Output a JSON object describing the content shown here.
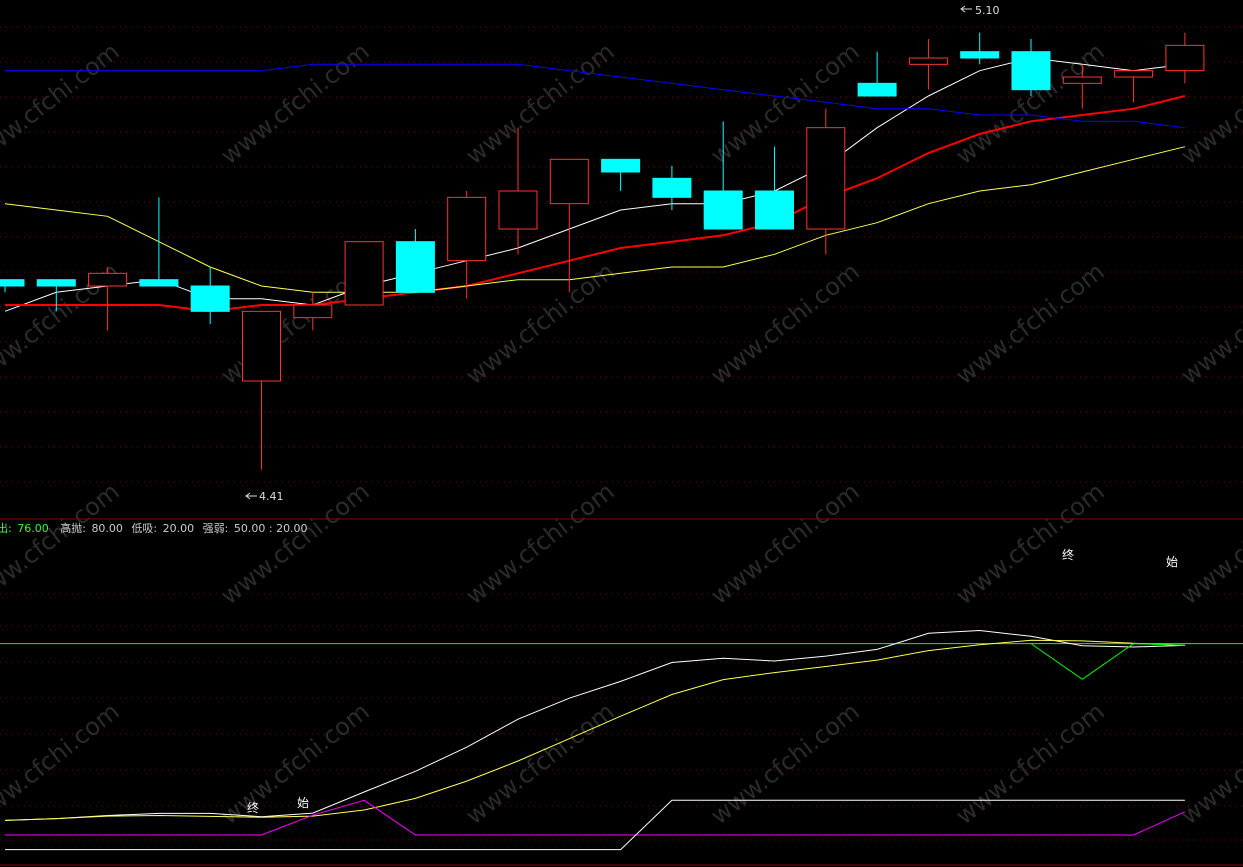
{
  "price_labels": {
    "high": "5.10",
    "low": "4.41"
  },
  "indicator_header": {
    "sell_label": "卖出:",
    "sell_value": "76.00",
    "high_label": "高抛:",
    "high_value": "80.00",
    "low_label": "低吸:",
    "low_value": "20.00",
    "strength_label": "强弱:",
    "strength_value": "50.00 : 20.00"
  },
  "markers": {
    "end": "终",
    "start": "始"
  },
  "watermark": "www.cfchi.com",
  "colors": {
    "background": "#000000",
    "up_candle": "#ff3232",
    "down_candle": "#00ffff",
    "ma_white": "#ffffff",
    "ma_red": "#ff0000",
    "ma_yellow": "#ffff55",
    "ma_blue": "#0000ff",
    "grid": "#8b0000",
    "osc_green": "#00ff00",
    "osc_magenta": "#ff00ff"
  },
  "chart_data": [
    {
      "type": "candlestick",
      "x": [
        0,
        1,
        2,
        3,
        4,
        5,
        6,
        7,
        8,
        9,
        10,
        11,
        12,
        13,
        14,
        15,
        16,
        17,
        18,
        19,
        20,
        21,
        22,
        23
      ],
      "candles": [
        {
          "o": 4.71,
          "h": 4.71,
          "l": 4.69,
          "c": 4.7
        },
        {
          "o": 4.71,
          "h": 4.71,
          "l": 4.66,
          "c": 4.7
        },
        {
          "o": 4.7,
          "h": 4.73,
          "l": 4.63,
          "c": 4.72
        },
        {
          "o": 4.71,
          "h": 4.84,
          "l": 4.7,
          "c": 4.7
        },
        {
          "o": 4.7,
          "h": 4.73,
          "l": 4.64,
          "c": 4.66
        },
        {
          "o": 4.55,
          "h": 4.66,
          "l": 4.41,
          "c": 4.66
        },
        {
          "o": 4.65,
          "h": 4.69,
          "l": 4.63,
          "c": 4.67
        },
        {
          "o": 4.67,
          "h": 4.77,
          "l": 4.67,
          "c": 4.77
        },
        {
          "o": 4.77,
          "h": 4.79,
          "l": 4.69,
          "c": 4.69
        },
        {
          "o": 4.74,
          "h": 4.85,
          "l": 4.68,
          "c": 4.84
        },
        {
          "o": 4.79,
          "h": 4.95,
          "l": 4.75,
          "c": 4.85
        },
        {
          "o": 4.83,
          "h": 4.9,
          "l": 4.69,
          "c": 4.9
        },
        {
          "o": 4.9,
          "h": 4.9,
          "l": 4.85,
          "c": 4.88
        },
        {
          "o": 4.87,
          "h": 4.89,
          "l": 4.82,
          "c": 4.84
        },
        {
          "o": 4.85,
          "h": 4.96,
          "l": 4.79,
          "c": 4.79
        },
        {
          "o": 4.85,
          "h": 4.92,
          "l": 4.8,
          "c": 4.79
        },
        {
          "o": 4.79,
          "h": 4.98,
          "l": 4.75,
          "c": 4.95
        },
        {
          "o": 5.02,
          "h": 5.07,
          "l": 5.01,
          "c": 5.0
        },
        {
          "o": 5.05,
          "h": 5.09,
          "l": 5.01,
          "c": 5.06
        },
        {
          "o": 5.07,
          "h": 5.1,
          "l": 5.05,
          "c": 5.06
        },
        {
          "o": 5.07,
          "h": 5.09,
          "l": 5.0,
          "c": 5.01
        },
        {
          "o": 5.02,
          "h": 5.05,
          "l": 4.98,
          "c": 5.03
        },
        {
          "o": 5.03,
          "h": 5.04,
          "l": 4.99,
          "c": 5.04
        },
        {
          "o": 5.04,
          "h": 5.1,
          "l": 5.02,
          "c": 5.08
        }
      ],
      "moving_averages": [
        {
          "color": "ma_white",
          "values": [
            4.66,
            4.69,
            4.7,
            4.71,
            4.68,
            4.68,
            4.67,
            4.7,
            4.72,
            4.74,
            4.76,
            4.79,
            4.82,
            4.83,
            4.83,
            4.85,
            4.89,
            4.95,
            5.0,
            5.04,
            5.06,
            5.05,
            5.04,
            5.05
          ]
        },
        {
          "color": "ma_red",
          "values": [
            4.67,
            4.67,
            4.67,
            4.67,
            4.66,
            4.67,
            4.67,
            4.68,
            4.69,
            4.7,
            4.72,
            4.74,
            4.76,
            4.77,
            4.78,
            4.8,
            4.84,
            4.87,
            4.91,
            4.94,
            4.96,
            4.97,
            4.98,
            5.0
          ]
        },
        {
          "color": "ma_yellow",
          "values": [
            4.83,
            4.82,
            4.81,
            4.77,
            4.73,
            4.7,
            4.69,
            4.69,
            4.69,
            4.7,
            4.71,
            4.71,
            4.72,
            4.73,
            4.73,
            4.75,
            4.78,
            4.8,
            4.83,
            4.85,
            4.86,
            4.88,
            4.9,
            4.92
          ]
        },
        {
          "color": "ma_blue",
          "values": [
            5.04,
            5.04,
            5.04,
            5.04,
            5.04,
            5.04,
            5.05,
            5.05,
            5.05,
            5.05,
            5.05,
            5.04,
            5.03,
            5.02,
            5.01,
            5.0,
            4.99,
            4.98,
            4.98,
            4.97,
            4.97,
            4.96,
            4.96,
            4.95
          ]
        }
      ],
      "ylim": [
        4.37,
        5.12
      ]
    },
    {
      "type": "line",
      "x": [
        0,
        1,
        2,
        3,
        4,
        5,
        6,
        7,
        8,
        9,
        10,
        11,
        12,
        13,
        14,
        15,
        16,
        17,
        18,
        19,
        20,
        21,
        22,
        23
      ],
      "ylim": [
        -5,
        100
      ],
      "series": [
        {
          "color": "ma_white",
          "values": [
            8.0,
            8.6,
            9.6,
            10.3,
            10.3,
            9.2,
            10.4,
            17.3,
            24.1,
            32.0,
            41.2,
            48.1,
            53.6,
            59.8,
            61.2,
            60.3,
            61.9,
            64.1,
            69.4,
            70.3,
            68.4,
            65.3,
            64.9,
            65.4
          ]
        },
        {
          "color": "ma_yellow",
          "values": [
            8.0,
            8.6,
            9.4,
            9.6,
            9.3,
            9.0,
            9.4,
            11.4,
            15.2,
            20.9,
            27.5,
            34.8,
            42.2,
            49.3,
            54.2,
            56.5,
            58.5,
            60.6,
            63.7,
            65.6,
            67.1,
            66.9,
            66.1,
            65.4
          ]
        },
        {
          "color": "osc_green",
          "values": [
            null,
            null,
            null,
            null,
            null,
            null,
            null,
            null,
            null,
            null,
            null,
            null,
            null,
            null,
            null,
            null,
            null,
            null,
            null,
            null,
            66.0,
            54.3,
            66.0,
            65.4
          ]
        },
        {
          "color": "osc_magenta",
          "values": [
            3.2,
            3.2,
            3.2,
            3.2,
            3.2,
            3.2,
            9.7,
            14.6,
            3.2,
            3.2,
            3.2,
            3.2,
            3.2,
            3.2,
            3.2,
            3.2,
            3.2,
            3.2,
            3.2,
            3.2,
            3.2,
            3.2,
            3.2,
            10.8
          ]
        },
        {
          "color": "ma_white",
          "values": [
            -1.6,
            -1.6,
            -1.6,
            -1.6,
            -1.6,
            -1.6,
            -1.6,
            -1.6,
            -1.6,
            -1.6,
            -1.6,
            -1.6,
            -1.6,
            14.6,
            14.6,
            14.6,
            14.6,
            14.6,
            14.6,
            14.6,
            14.6,
            14.6,
            14.6,
            14.6
          ]
        }
      ],
      "reference_lines": [
        {
          "color": "osc_green",
          "value": 66.0
        }
      ]
    }
  ]
}
